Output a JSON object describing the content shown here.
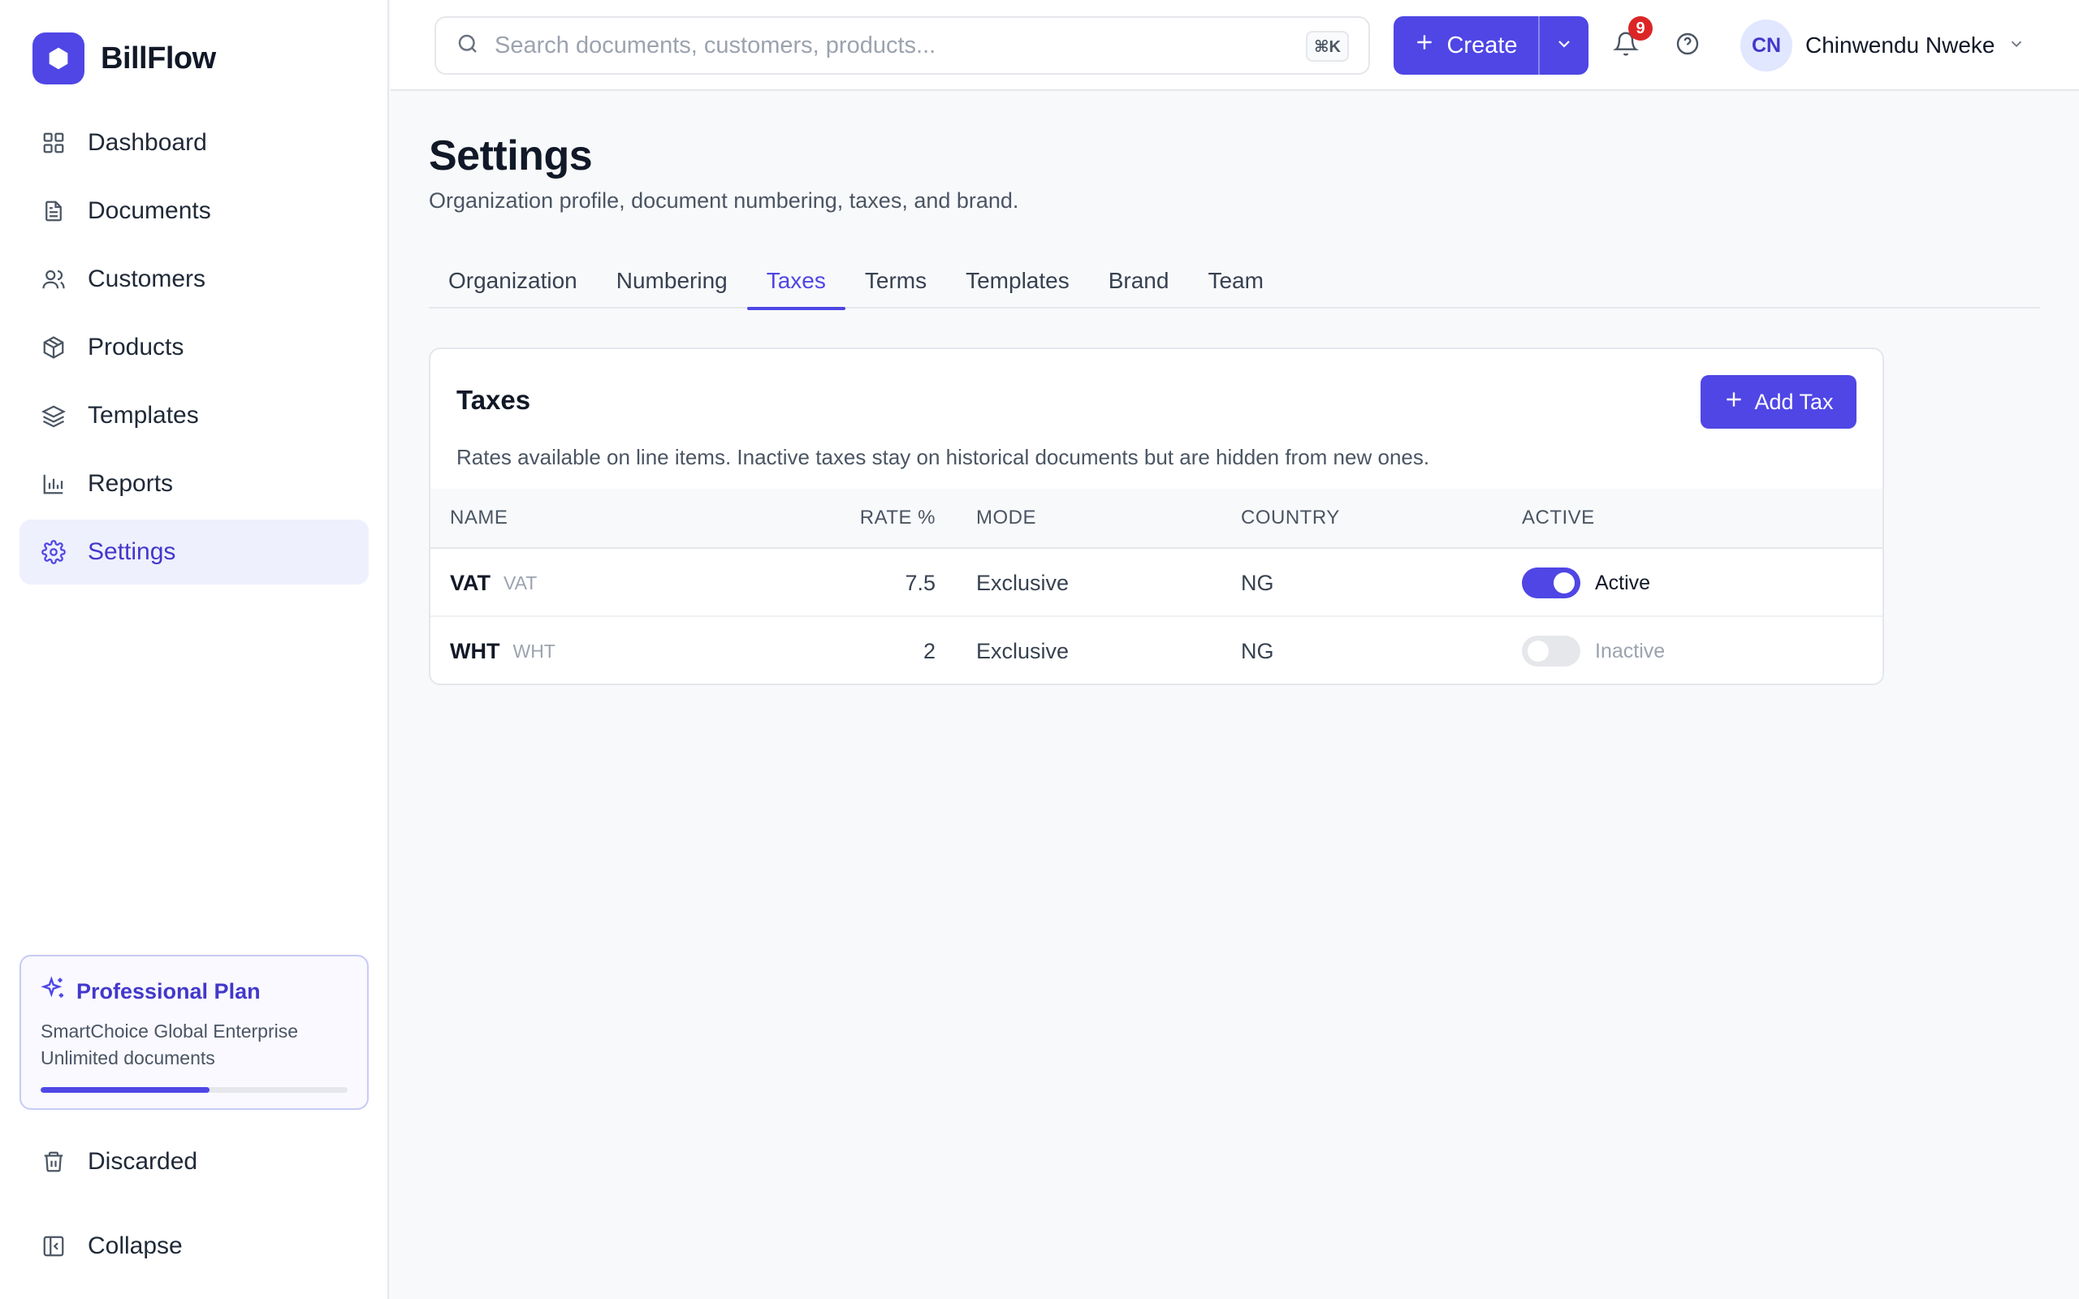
{
  "app": {
    "name": "BillFlow"
  },
  "sidebar": {
    "items": [
      {
        "label": "Dashboard",
        "icon": "dashboard-icon"
      },
      {
        "label": "Documents",
        "icon": "document-icon"
      },
      {
        "label": "Customers",
        "icon": "users-icon"
      },
      {
        "label": "Products",
        "icon": "box-icon"
      },
      {
        "label": "Templates",
        "icon": "layers-icon"
      },
      {
        "label": "Reports",
        "icon": "bar-chart-icon"
      },
      {
        "label": "Settings",
        "icon": "gear-icon",
        "active": true
      }
    ],
    "plan": {
      "name": "Professional Plan",
      "org": "SmartChoice Global Enterprise",
      "docs": "Unlimited documents",
      "usage_fraction": 0.55
    },
    "discarded_label": "Discarded",
    "collapse_label": "Collapse"
  },
  "topbar": {
    "search_placeholder": "Search documents, customers, products...",
    "search_shortcut": "⌘K",
    "create_label": "Create",
    "notifications_count": "9",
    "user": {
      "initials": "CN",
      "name": "Chinwendu Nweke"
    }
  },
  "page": {
    "title": "Settings",
    "subtitle": "Organization profile, document numbering, taxes, and brand.",
    "tabs": [
      {
        "label": "Organization"
      },
      {
        "label": "Numbering"
      },
      {
        "label": "Taxes",
        "active": true
      },
      {
        "label": "Terms"
      },
      {
        "label": "Templates"
      },
      {
        "label": "Brand"
      },
      {
        "label": "Team"
      }
    ]
  },
  "taxes": {
    "title": "Taxes",
    "description": "Rates available on line items. Inactive taxes stay on historical documents but are hidden from new ones.",
    "add_label": "Add Tax",
    "columns": {
      "name": "NAME",
      "rate": "RATE %",
      "mode": "MODE",
      "country": "COUNTRY",
      "active": "ACTIVE"
    },
    "rows": [
      {
        "name": "VAT",
        "code": "VAT",
        "rate": "7.5",
        "mode": "Exclusive",
        "country": "NG",
        "active": true,
        "status": "Active"
      },
      {
        "name": "WHT",
        "code": "WHT",
        "rate": "2",
        "mode": "Exclusive",
        "country": "NG",
        "active": false,
        "status": "Inactive"
      }
    ]
  },
  "colors": {
    "accent": "#4f46e5",
    "active_bg": "#eef0fd",
    "badge": "#dc2626"
  }
}
